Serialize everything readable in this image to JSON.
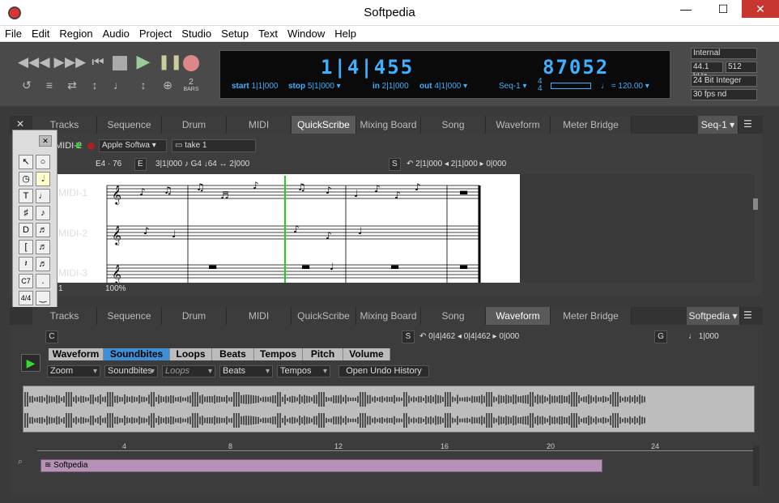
{
  "window": {
    "title": "Softpedia"
  },
  "menu": [
    "File",
    "Edit",
    "Region",
    "Audio",
    "Project",
    "Studio",
    "Setup",
    "Text",
    "Window",
    "Help"
  ],
  "transport": {
    "counter_main": "1|4|455",
    "counter_time": "87052",
    "start_label": "start",
    "start_value": "1|1|000",
    "stop_label": "stop",
    "stop_value": "5|1|000",
    "in_label": "in",
    "in_value": "2|1|000",
    "out_label": "out",
    "out_value": "4|1|000",
    "seq": "Seq-1",
    "meter_top": "4",
    "meter_bottom": "4",
    "tempo": "120.00",
    "bars_label": "BARS",
    "bars_value": "2",
    "sync": "Internal",
    "sample_rate": "44.1 kHz",
    "buffer": "512",
    "bit_depth": "24 Bit Integer",
    "frame_rate": "30 fps nd"
  },
  "top_tabs": [
    "Tracks",
    "Sequence",
    "Drum",
    "MIDI",
    "QuickScribe",
    "Mixing Board",
    "Song",
    "Waveform",
    "Meter Bridge"
  ],
  "top_active": "QuickScribe",
  "top_seq": "Seq-1",
  "score": {
    "track_name": "MIDI-2",
    "instrument": "Apple Softwa",
    "take": "take 1",
    "pitch_readout": "E4 · 76",
    "e_label": "E",
    "pos1": "3|1|000",
    "note": "G4",
    "vel": "64",
    "dur": "2|000",
    "s_label": "S",
    "s_pos1": "2|1|000",
    "s_pos2": "2|1|000",
    "s_pos3": "0|000",
    "staves": [
      "MIDI-1",
      "MIDI-2",
      "MIDI-3"
    ],
    "zoom": "100%",
    "page": "1"
  },
  "bottom_tabs": [
    "Tracks",
    "Sequence",
    "Drum",
    "MIDI",
    "QuickScribe",
    "Mixing Board",
    "Song",
    "Waveform",
    "Meter Bridge"
  ],
  "bottom_active": "Waveform",
  "bottom_seq": "Softpedia",
  "waveform": {
    "c_label": "C",
    "s_label": "S",
    "s_pos1": "0|4|462",
    "s_pos2": "0|4|462",
    "s_pos3": "0|000",
    "g_label": "G",
    "g_value": "1|000",
    "subtabs": [
      "Waveform",
      "Soundbites",
      "Loops",
      "Beats",
      "Tempos",
      "Pitch",
      "Volume"
    ],
    "subtab_active": "Soundbites",
    "dropdowns": [
      "Zoom",
      "Soundbites",
      "Loops",
      "Beats",
      "Tempos"
    ],
    "undo_button": "Open Undo History",
    "ruler": [
      "4",
      "8",
      "12",
      "16",
      "20",
      "24"
    ],
    "region_name": "Softpedia"
  }
}
